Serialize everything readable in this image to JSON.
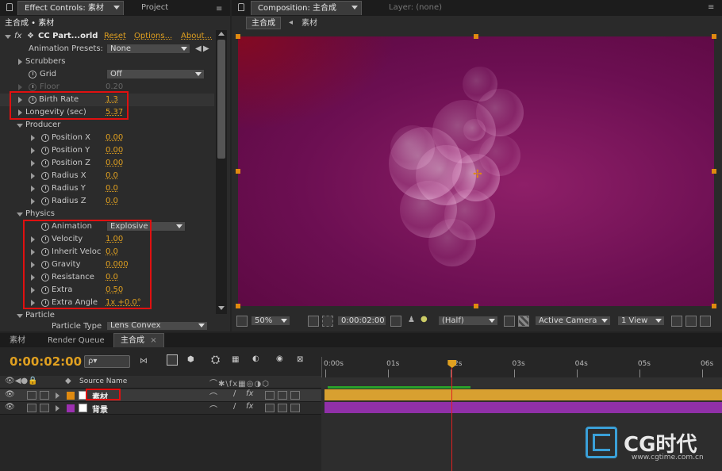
{
  "panels": {
    "effect_controls_tab": "Effect Controls: 素材",
    "project_tab": "Project",
    "composition_tab": "Composition: 主合成",
    "layer_tab": "Layer: (none)"
  },
  "effect_controls": {
    "breadcrumb": "主合成 • 素材",
    "effect_name": "CC Part...orld",
    "reset": "Reset",
    "options": "Options...",
    "about": "About...",
    "presets_label": "Animation Presets:",
    "presets_value": "None",
    "scrubbers": "Scrubbers",
    "grid_label": "Grid",
    "grid_value": "Off",
    "floor_label": "Floor",
    "floor_value": "0.20",
    "birth_rate_label": "Birth Rate",
    "birth_rate_value": "1.3",
    "longevity_label": "Longevity (sec)",
    "longevity_value": "5.37",
    "producer": "Producer",
    "producer_items": [
      {
        "label": "Position X",
        "value": "0.00"
      },
      {
        "label": "Position Y",
        "value": "0.00"
      },
      {
        "label": "Position Z",
        "value": "0.00"
      },
      {
        "label": "Radius X",
        "value": "0.0"
      },
      {
        "label": "Radius Y",
        "value": "0.0"
      },
      {
        "label": "Radius Z",
        "value": "0.0"
      }
    ],
    "physics": "Physics",
    "animation_label": "Animation",
    "animation_value": "Explosive",
    "physics_items": [
      {
        "label": "Velocity",
        "value": "1.00"
      },
      {
        "label": "Inherit Veloc",
        "value": "0.0"
      },
      {
        "label": "Gravity",
        "value": "0.000"
      },
      {
        "label": "Resistance",
        "value": "0.0"
      },
      {
        "label": "Extra",
        "value": "0.50"
      },
      {
        "label": "Extra Angle",
        "value": "1x +0.0°"
      }
    ],
    "particle": "Particle",
    "particle_type_label": "Particle Type",
    "particle_type_value": "Lens Convex"
  },
  "composition": {
    "subtab_active": "主合成",
    "subtab_other": "素材",
    "zoom": "50%",
    "timecode": "0:00:02:00",
    "resolution": "(Half)",
    "camera": "Active Camera",
    "view": "1 View"
  },
  "timeline": {
    "tabs": [
      "素材",
      "Render Queue",
      "主合成"
    ],
    "timecode": "0:00:02:00",
    "search_placeholder": "ρ▾",
    "source_name_header": "Source Name",
    "ruler": [
      "0:00s",
      "01s",
      "02s",
      "03s",
      "04s",
      "05s",
      "06s"
    ],
    "current_time_fraction": 0.25,
    "layers": [
      {
        "name": "素材",
        "color": "#e08a10",
        "bar_color": "#d8a030"
      },
      {
        "name": "背景",
        "color": "#9b30b0",
        "bar_color": "#9030a8"
      }
    ]
  },
  "watermark": {
    "brand": "CG时代",
    "url": "www.cgtime.com.cn"
  },
  "colors": {
    "accent": "#e0a020",
    "highlight_box": "#e01010"
  }
}
